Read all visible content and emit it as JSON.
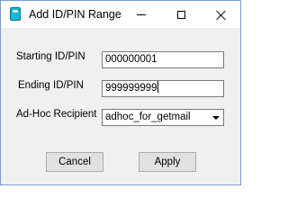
{
  "window": {
    "title": "Add ID/PIN Range",
    "icon": "app-icon",
    "controls": [
      "minimize-icon",
      "maximize-icon",
      "close-icon"
    ]
  },
  "form": {
    "starting_label": "Starting ID/PIN",
    "starting_value": "000000001",
    "ending_label": "Ending ID/PIN",
    "ending_value": "999999999",
    "recipient_label": "Ad-Hoc Recipient",
    "recipient_value": "adhoc_for_getmail"
  },
  "buttons": {
    "cancel_label": "Cancel",
    "apply_label": "Apply"
  },
  "colors": {
    "window_border": "#7a9cd3",
    "dialog_background": "#f0f0f0",
    "icon_accent": "#16b7d6"
  }
}
